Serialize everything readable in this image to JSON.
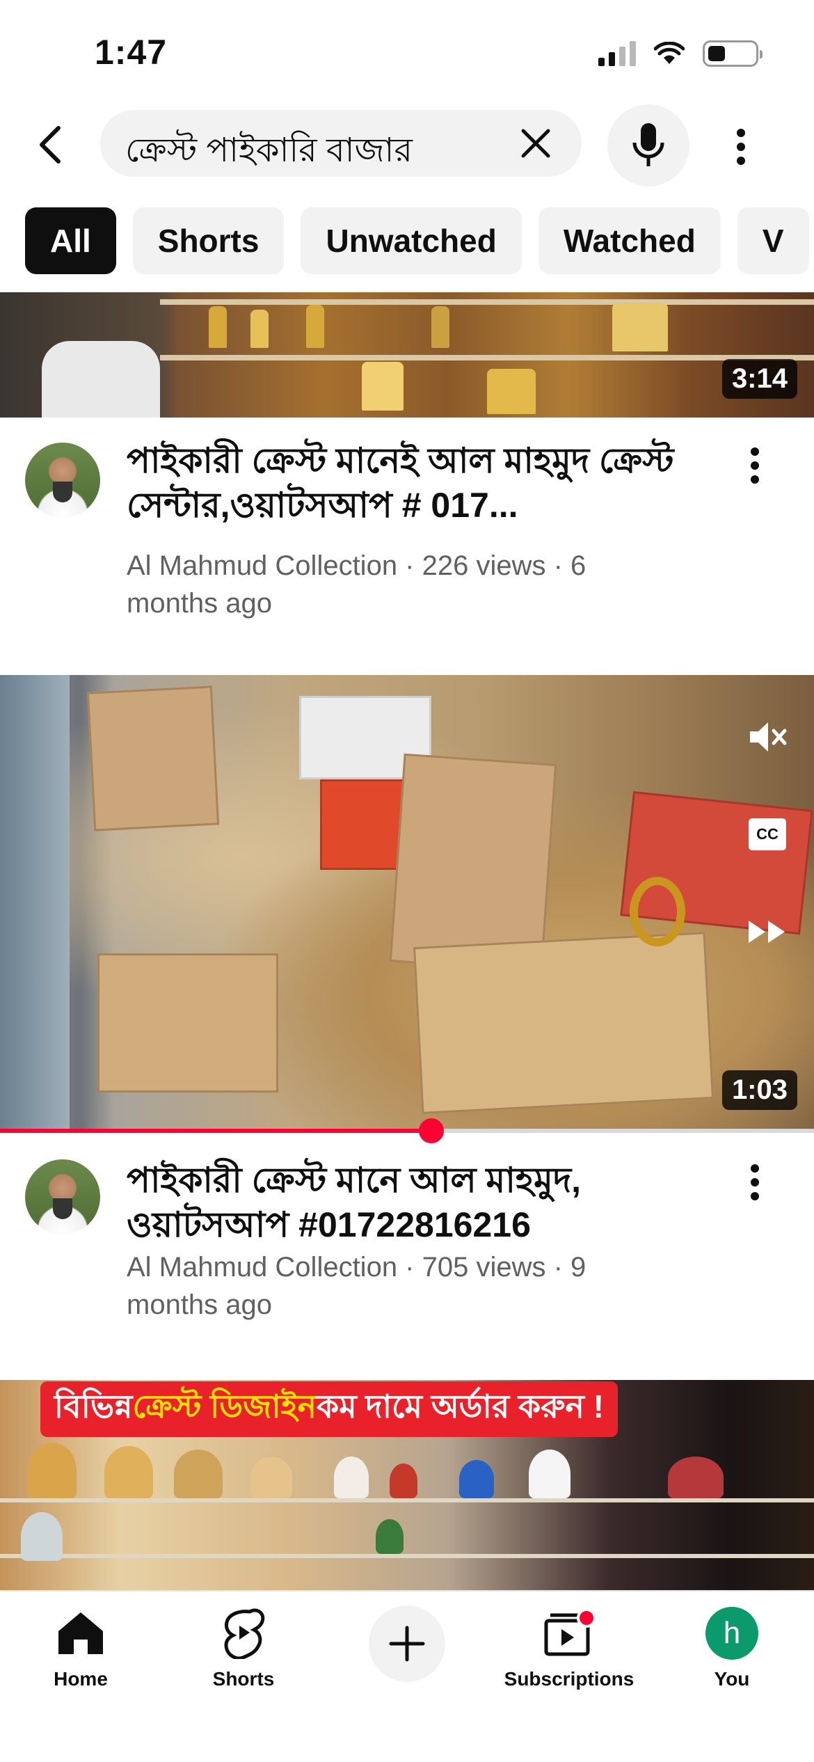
{
  "status_bar": {
    "time": "1:47"
  },
  "search": {
    "query": "ক্রেস্ট পাইকারি বাজার"
  },
  "chips": [
    "All",
    "Shorts",
    "Unwatched",
    "Watched",
    "V"
  ],
  "videos": [
    {
      "duration": "3:14",
      "title": "পাইকারী ক্রেস্ট মানেই আল মাহমুদ ক্রেস্ট সেন্টার,ওয়াটসআপ # 017...",
      "subtitle": "Al Mahmud Collection · 226 views · 6 months ago"
    },
    {
      "duration": "1:03",
      "title": "পাইকারী ক্রেস্ট মানে আল মাহমুদ, ওয়াটসআপ #01722816216",
      "subtitle": "Al Mahmud Collection · 705 views · 9 months ago",
      "playback_progress": 0.53,
      "cc_label": "CC"
    },
    {
      "banner_prefix": "বিভিন্ন ",
      "banner_highlight": "ক্রেস্ট ডিজাইন",
      "banner_suffix": " কম দামে অর্ডার করুন !"
    }
  ],
  "bottom_nav": {
    "home": "Home",
    "shorts": "Shorts",
    "subscriptions": "Subscriptions",
    "you": "You",
    "you_initial": "h"
  },
  "colors": {
    "accent": "#ff0033",
    "chip_bg": "#f2f2f2",
    "subtext": "#606060",
    "avatar_you": "#0a9a6b"
  }
}
